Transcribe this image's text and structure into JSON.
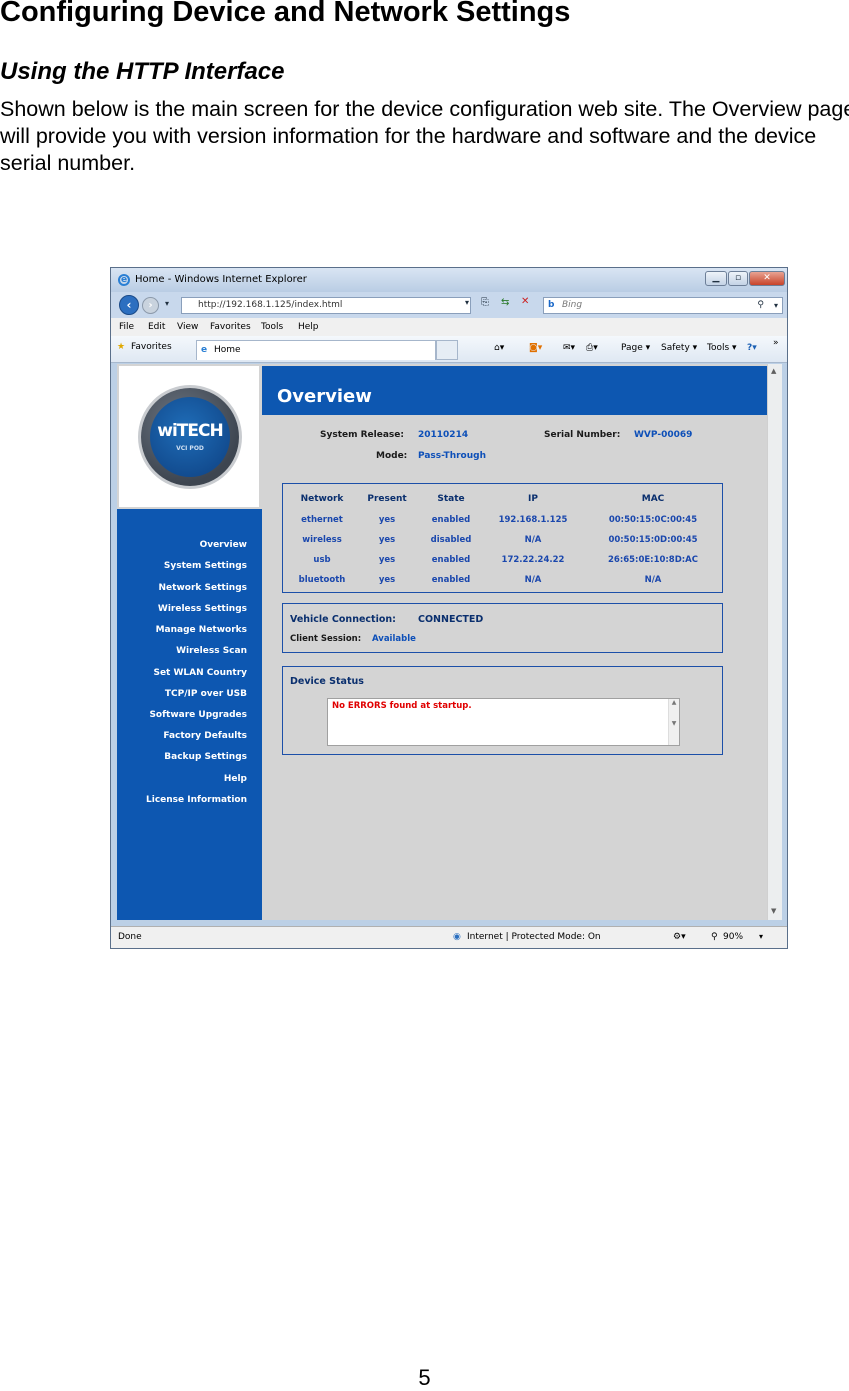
{
  "document": {
    "heading": "Configuring Device and Network Settings",
    "subheading": "Using the HTTP Interface",
    "paragraph": "Shown below is the main screen for the device configuration web site.  The Overview page will provide you with version information for the hardware and software and the device serial number.",
    "page_number": "5"
  },
  "browser": {
    "title": "Home - Windows Internet Explorer",
    "url": "http://192.168.1.125/index.html",
    "search_placeholder": "Bing",
    "menu": [
      "File",
      "Edit",
      "View",
      "Favorites",
      "Tools",
      "Help"
    ],
    "favorites_label": "Favorites",
    "tab_label": "Home",
    "toolbar": {
      "page": "Page",
      "safety": "Safety",
      "tools": "Tools"
    },
    "status": {
      "left": "Done",
      "zone": "Internet | Protected Mode: On",
      "zoom": "90%"
    }
  },
  "app": {
    "logo_text": "wiTECH",
    "logo_sub": "VCI POD",
    "nav": [
      "Overview",
      "System Settings",
      "Network Settings",
      "Wireless Settings",
      "Manage Networks",
      "Wireless Scan",
      "Set WLAN Country",
      "TCP/IP over USB",
      "Software Upgrades",
      "Factory Defaults",
      "Backup Settings",
      "Help",
      "License Information"
    ],
    "overview": {
      "title": "Overview",
      "system_release_label": "System Release:",
      "system_release": "20110214",
      "serial_label": "Serial Number:",
      "serial": "WVP-00069",
      "mode_label": "Mode:",
      "mode": "Pass-Through"
    },
    "network_table": {
      "headers": [
        "Network",
        "Present",
        "State",
        "IP",
        "MAC"
      ],
      "rows": [
        [
          "ethernet",
          "yes",
          "enabled",
          "192.168.1.125",
          "00:50:15:0C:00:45"
        ],
        [
          "wireless",
          "yes",
          "disabled",
          "N/A",
          "00:50:15:0D:00:45"
        ],
        [
          "usb",
          "yes",
          "enabled",
          "172.22.24.22",
          "26:65:0E:10:8D:AC"
        ],
        [
          "bluetooth",
          "yes",
          "enabled",
          "N/A",
          "N/A"
        ]
      ]
    },
    "vehicle": {
      "connection_label": "Vehicle Connection:",
      "connection_value": "CONNECTED",
      "session_label": "Client Session:",
      "session_value": "Available"
    },
    "device_status": {
      "title": "Device Status",
      "message": "No ERRORS found at startup."
    }
  }
}
